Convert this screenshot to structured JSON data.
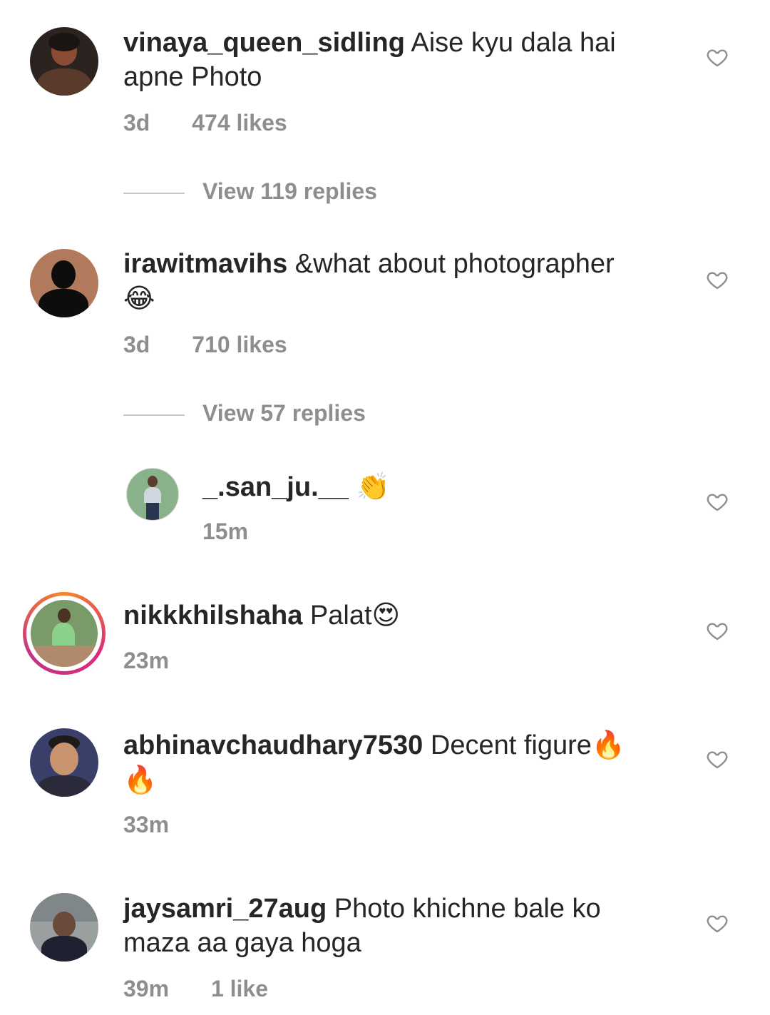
{
  "comments": [
    {
      "username": "vinaya_queen_sidling",
      "text": "Aise kyu dala hai apne Photo",
      "time": "3d",
      "likes": "474 likes",
      "view_replies": "View 119 replies"
    },
    {
      "username": "irawitmavihs",
      "text": "&what about photographer",
      "emoji": "😂",
      "time": "3d",
      "likes": "710 likes",
      "view_replies": "View 57 replies"
    },
    {
      "username": "nikkkhilshaha",
      "text": "Palat",
      "emoji": "😍",
      "time": "23m"
    },
    {
      "username": "abhinavchaudhary7530",
      "text": "Decent figure",
      "emoji": "🔥",
      "emoji2": "🔥",
      "time": "33m"
    },
    {
      "username": "jaysamri_27aug",
      "text": "Photo khichne bale ko maza aa gaya hoga",
      "time": "39m",
      "likes": "1 like"
    }
  ],
  "reply": {
    "username": "_.san_ju.__",
    "emoji": "👏",
    "time": "15m"
  },
  "icons": {
    "like": "heart-outline-icon"
  },
  "colors": {
    "text": "#262626",
    "meta": "#8e8e8e",
    "story_ring_start": "#f58529",
    "story_ring_end": "#dd2a7b"
  }
}
